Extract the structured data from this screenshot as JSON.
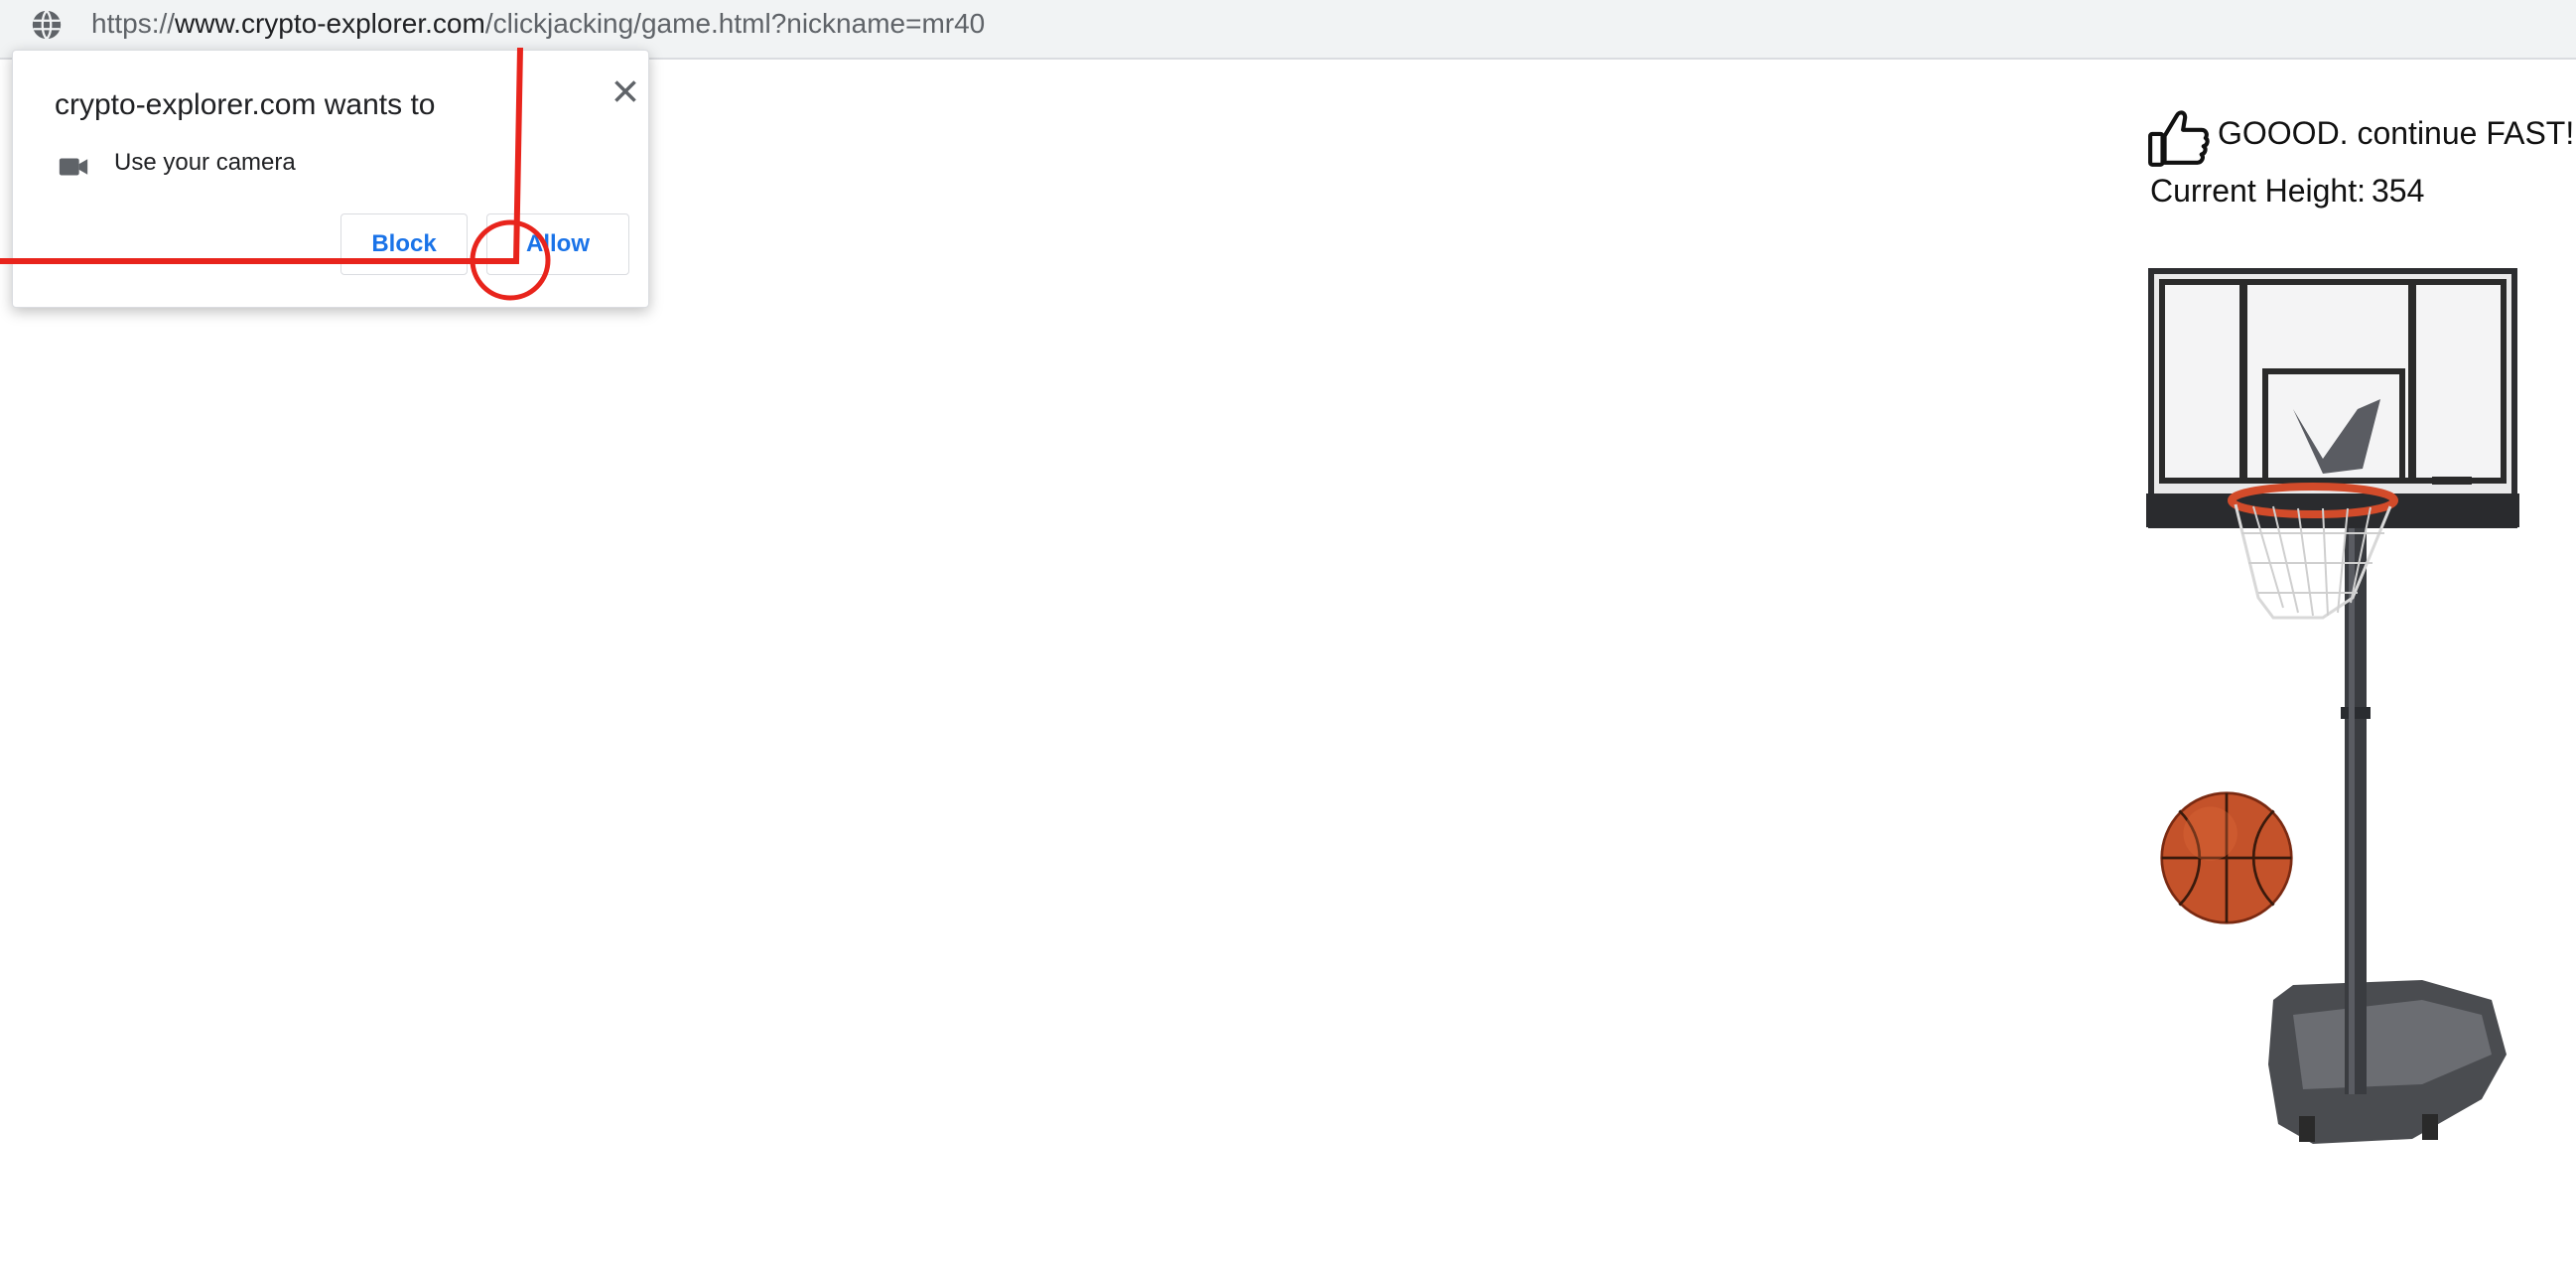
{
  "browser": {
    "url_scheme": "https://",
    "url_host": "www.crypto-explorer.com",
    "url_path": "/clickjacking/game.html?nickname=mr40"
  },
  "permission_popup": {
    "title": "crypto-explorer.com wants to",
    "permission": "Use your camera",
    "block_label": "Block",
    "allow_label": "Allow"
  },
  "game": {
    "message": "GOOOD. continue FAST!",
    "height_label": "Current Height:",
    "height_value": "354"
  },
  "colors": {
    "accent_blue": "#1a73e8",
    "annotation_red": "#e8241c"
  }
}
